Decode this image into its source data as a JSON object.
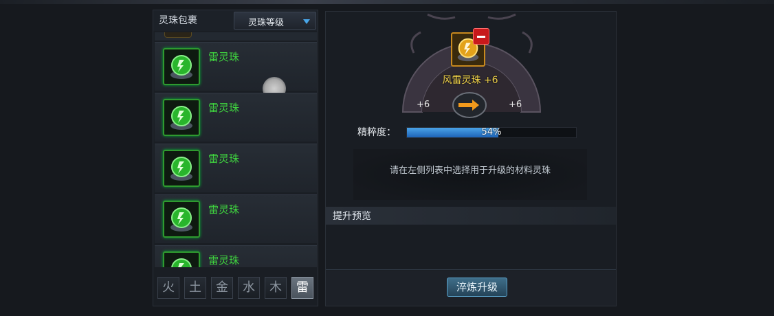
{
  "inventory": {
    "title": "灵珠包裹",
    "sort_dropdown": "灵珠等级",
    "items": [
      {
        "name": "雷灵珠"
      },
      {
        "name": "雷灵珠"
      },
      {
        "name": "雷灵珠"
      },
      {
        "name": "雷灵珠"
      },
      {
        "name": "雷灵珠"
      }
    ],
    "element_tabs": [
      "火",
      "土",
      "金",
      "水",
      "木",
      "雷"
    ],
    "active_tab": "雷"
  },
  "upgrade": {
    "item_name": "风雷灵珠 +6",
    "level_from": "+6",
    "level_to": "+6",
    "purity_label": "精粹度：",
    "purity_percent": 54,
    "purity_text": "54%",
    "hint": "请在左侧列表中选择用于升级的材料灵珠",
    "preview_title": "提升预览",
    "refine_button": "淬炼升级"
  },
  "colors": {
    "item_name_green": "#3fd43f",
    "item_name_gold": "#f0d24a",
    "progress_blue": "#2d7fd0",
    "remove_red": "#c7191b"
  },
  "icons": {
    "pearl": "thunder-pearl-icon",
    "remove": "minus-icon",
    "arrow": "right-arrow-icon"
  }
}
